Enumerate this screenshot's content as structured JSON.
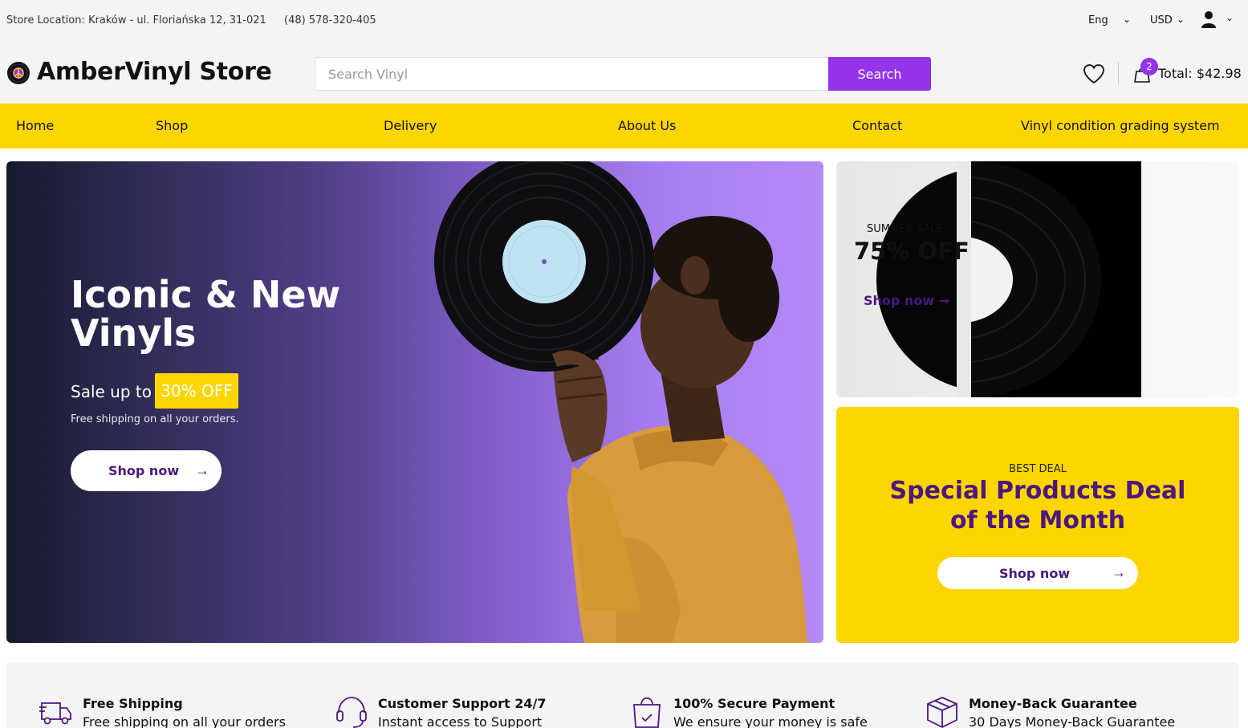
{
  "topbar": {
    "location": "Store Location: Kraków - ul. Floriańska 12, 31-021",
    "phone": "(48) 578-320-405",
    "language": "Eng",
    "currency": "USD"
  },
  "header": {
    "logo_text": "AmberVinyl Store",
    "search_placeholder": "Search Vinyl",
    "search_button": "Search",
    "cart_count": "2",
    "cart_total": "Total: $42.98"
  },
  "nav": {
    "items": [
      "Home",
      "Shop",
      "Delivery",
      "About Us",
      "Contact",
      "Vinyl condition grading system"
    ]
  },
  "hero": {
    "title": "Iconic & New Vinyls",
    "sale_text": "Sale up to",
    "sale_badge": "30% OFF",
    "subtitle": "Free shipping on all your orders.",
    "button": "Shop now"
  },
  "promo_sale": {
    "eyebrow": "SUMMER SALE",
    "title": "75% OFF",
    "link": "Shop now"
  },
  "promo_deal": {
    "eyebrow": "BEST DEAL",
    "title": "Special Products Deal of the Month",
    "button": "Shop now"
  },
  "features": [
    {
      "title": "Free Shipping",
      "subtitle": "Free shipping on all your orders",
      "icon": "truck-icon"
    },
    {
      "title": "Customer Support 24/7",
      "subtitle": "Instant access to Support",
      "icon": "headset-icon"
    },
    {
      "title": "100% Secure Payment",
      "subtitle": "We ensure your money is safe",
      "icon": "shopping-bag-icon"
    },
    {
      "title": "Money-Back Guarantee",
      "subtitle": "30 Days Money-Back Guarantee",
      "icon": "box-icon"
    }
  ],
  "colors": {
    "accent": "#9333ea",
    "brand_purple": "#4c1780",
    "nav_yellow": "#fdd600"
  }
}
